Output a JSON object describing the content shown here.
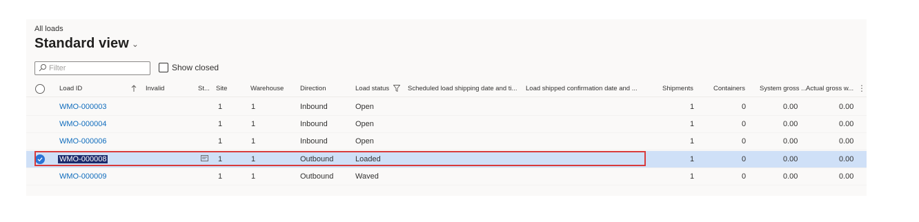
{
  "breadcrumb": "All loads",
  "view_title": "Standard view",
  "filter": {
    "placeholder": "Filter"
  },
  "show_closed": {
    "label": "Show closed",
    "checked": false
  },
  "colors": {
    "link": "#0f6cbd",
    "selected_row": "#cfe0f7",
    "highlight_box": "#d83b3b",
    "check": "#2b74d6"
  },
  "columns": {
    "load_id": "Load ID",
    "invalid": "Invalid",
    "status_short": "St...",
    "site": "Site",
    "warehouse": "Warehouse",
    "direction": "Direction",
    "load_status": "Load status",
    "scheduled": "Scheduled load shipping date and ti...",
    "confirmed": "Load shipped confirmation date and ...",
    "shipments": "Shipments",
    "containers": "Containers",
    "system_gross": "System gross ...",
    "actual_gross": "Actual gross w..."
  },
  "icons": {
    "filter": "search-icon",
    "sort": "sort-ascending-icon",
    "funnel": "filter-funnel-icon",
    "more": "more-options-icon",
    "note": "note-icon",
    "check": "checkmark-icon"
  },
  "rows": [
    {
      "load_id": "WMO-000003",
      "site": "1",
      "warehouse": "1",
      "direction": "Inbound",
      "load_status": "Open",
      "shipments": "1",
      "containers": "0",
      "system_gross": "0.00",
      "actual_gross": "0.00",
      "selected": false
    },
    {
      "load_id": "WMO-000004",
      "site": "1",
      "warehouse": "1",
      "direction": "Inbound",
      "load_status": "Open",
      "shipments": "1",
      "containers": "0",
      "system_gross": "0.00",
      "actual_gross": "0.00",
      "selected": false
    },
    {
      "load_id": "WMO-000006",
      "site": "1",
      "warehouse": "1",
      "direction": "Inbound",
      "load_status": "Open",
      "shipments": "1",
      "containers": "0",
      "system_gross": "0.00",
      "actual_gross": "0.00",
      "selected": false
    },
    {
      "load_id": "WMO-000008",
      "site": "1",
      "warehouse": "1",
      "direction": "Outbound",
      "load_status": "Loaded",
      "shipments": "1",
      "containers": "0",
      "system_gross": "0.00",
      "actual_gross": "0.00",
      "selected": true
    },
    {
      "load_id": "WMO-000009",
      "site": "1",
      "warehouse": "1",
      "direction": "Outbound",
      "load_status": "Waved",
      "shipments": "1",
      "containers": "0",
      "system_gross": "0.00",
      "actual_gross": "0.00",
      "selected": false
    }
  ]
}
